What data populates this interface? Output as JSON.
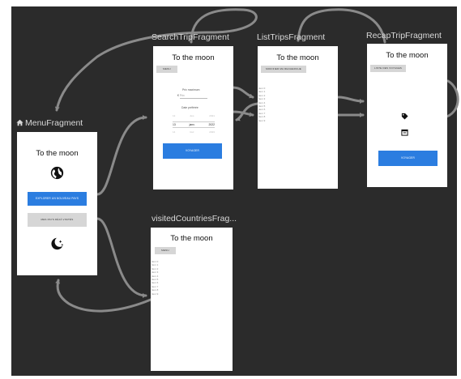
{
  "fragments": {
    "menu": {
      "title": "MenuFragment",
      "app_title": "To the moon",
      "explore_button": "EXPLORER UN NOUVEAU PAYS",
      "visited_button": "MES PAYS DÉJÀ VISITÉS"
    },
    "search": {
      "title": "SearchTripFragment",
      "app_title": "To the moon",
      "menu_button": "MENU",
      "price_label": "Prix maximum",
      "price_placeholder": "Prix",
      "date_label": "Date préférée",
      "date_picker": {
        "rows": [
          [
            "12",
            "déc.",
            "2021"
          ],
          [
            "13",
            "janv.",
            "2022"
          ],
          [
            "14",
            "févr.",
            "2023"
          ]
        ]
      },
      "voyager_button": "VOYAGER"
    },
    "list": {
      "title": "ListTripsFragment",
      "app_title": "To the moon",
      "modify_button": "MODIFIER MA RECHERCHE",
      "items": [
        "Item 0",
        "Item 1",
        "Item 2",
        "Item 3",
        "Item 4",
        "Item 5",
        "Item 6",
        "Item 7",
        "Item 8",
        "Item 9"
      ]
    },
    "recap": {
      "title": "RecapTripFragment",
      "app_title": "To the moon",
      "list_button": "LISTE DES VOYAGES",
      "voyager_button": "VOYAGER"
    },
    "visited": {
      "title": "visitedCountriesFrag...",
      "app_title": "To the moon",
      "menu_button": "MENU",
      "items": [
        "Item 0",
        "Item 1",
        "Item 2",
        "Item 3",
        "Item 4",
        "Item 5",
        "Item 6",
        "Item 7",
        "Item 8",
        "Item 9"
      ]
    }
  },
  "colors": {
    "canvas_bg": "#2b2b2b",
    "arrow": "#8a8a8a",
    "accent_button": "#2b7de0",
    "secondary_button": "#d6d6d6"
  },
  "icons": [
    "home-icon",
    "globe-icon",
    "moon-stars-icon",
    "tag-icon",
    "calendar-icon"
  ]
}
